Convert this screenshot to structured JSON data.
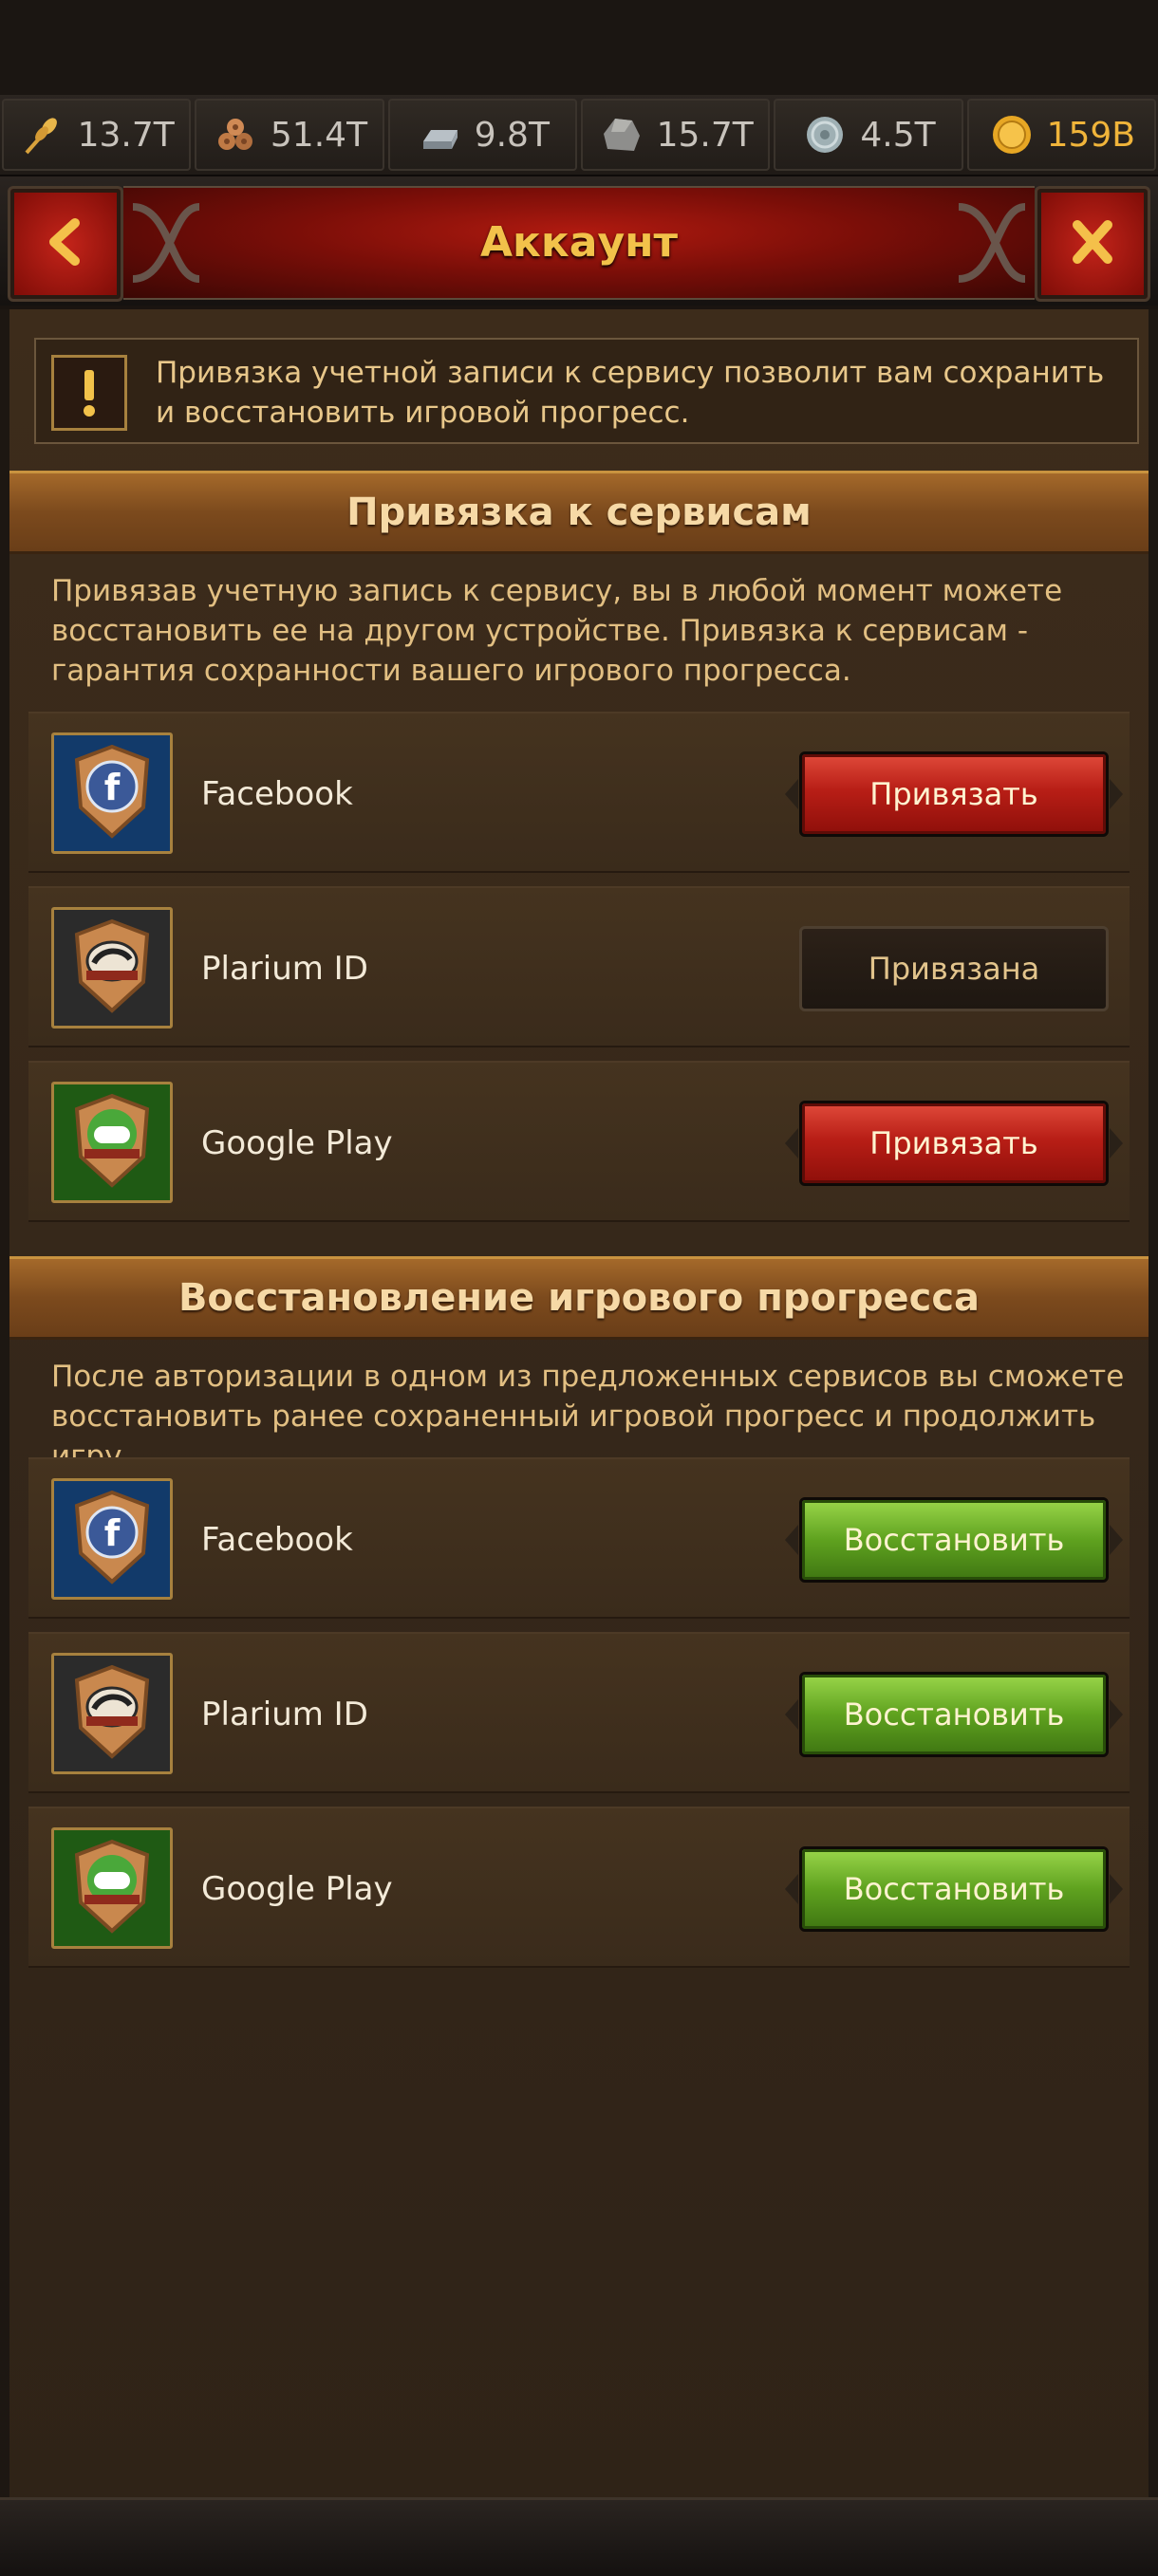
{
  "resources": [
    {
      "icon": "wheat-icon",
      "value": "13.7T"
    },
    {
      "icon": "logs-icon",
      "value": "51.4T"
    },
    {
      "icon": "iron-ingot-icon",
      "value": "9.8T"
    },
    {
      "icon": "stone-icon",
      "value": "15.7T"
    },
    {
      "icon": "silver-coin-icon",
      "value": "4.5T"
    },
    {
      "icon": "gold-coin-icon",
      "value": "159B"
    }
  ],
  "header": {
    "title": "Аккаунт",
    "back_icon": "back-chevron-icon",
    "close_icon": "close-x-icon"
  },
  "notice": {
    "text": "Привязка учетной записи к сервису позволит вам сохранить и восстановить игровой прогресс."
  },
  "link_section": {
    "title": "Привязка к сервисам",
    "description": "Привязав учетную запись к сервису, вы в любой момент можете восстановить ее на другом устройстве. Привязка к сервисам - гарантия сохранности вашего игрового прогресса.",
    "items": [
      {
        "name": "Facebook",
        "action": "Привязать",
        "state": "link"
      },
      {
        "name": "Plarium ID",
        "action": "Привязана",
        "state": "linked"
      },
      {
        "name": "Google Play",
        "action": "Привязать",
        "state": "link"
      }
    ]
  },
  "restore_section": {
    "title": "Восстановление игрового прогресса",
    "description": "После авторизации в одном из предложенных сервисов вы сможете восстановить ранее сохраненный игровой прогресс и продолжить игру.",
    "items": [
      {
        "name": "Facebook",
        "action": "Восстановить"
      },
      {
        "name": "Plarium ID",
        "action": "Восстановить"
      },
      {
        "name": "Google Play",
        "action": "Восстановить"
      }
    ]
  },
  "colors": {
    "accent_gold": "#f2c24a",
    "red_button": "#b81e16",
    "green_button": "#5fa21f",
    "panel_brown": "#3d2c1b"
  }
}
